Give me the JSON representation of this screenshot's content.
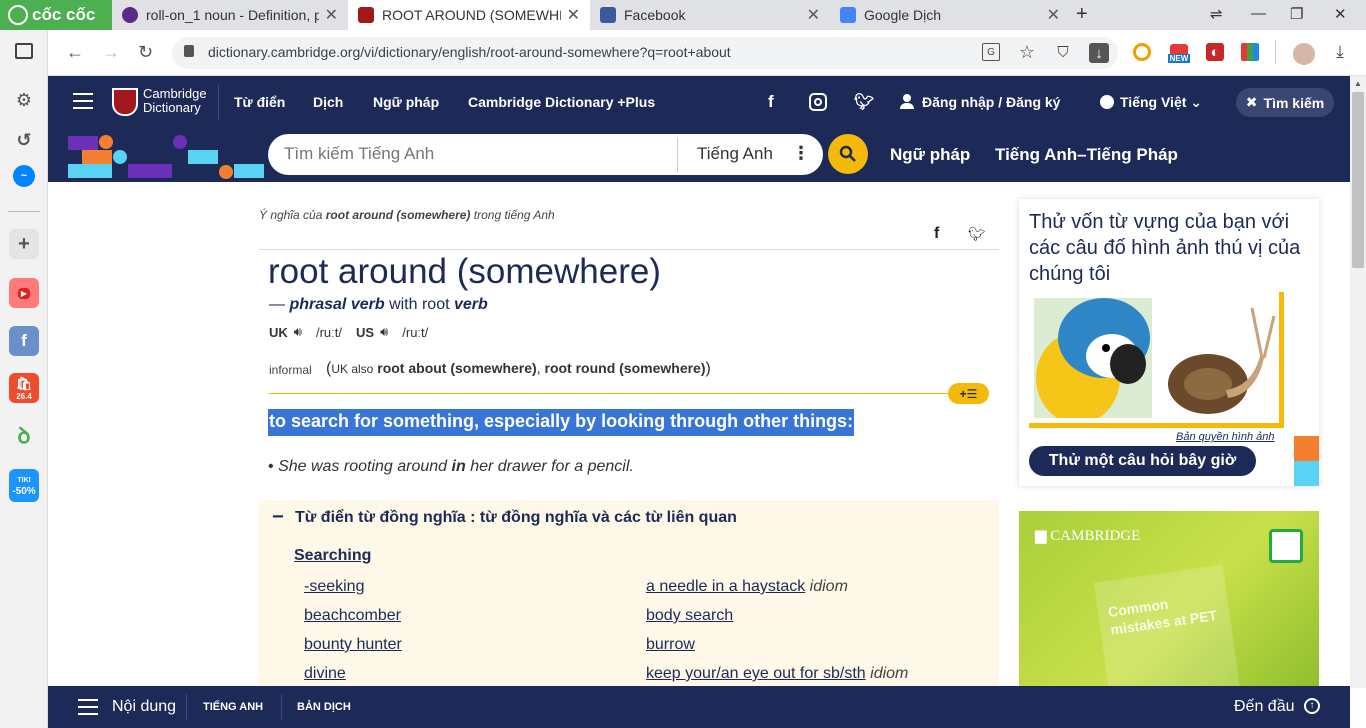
{
  "browser": {
    "brand": "cốc cốc",
    "tabs": [
      {
        "title": "roll-on_1 noun - Definition, p"
      },
      {
        "title": "ROOT AROUND (SOMEWHERE"
      },
      {
        "title": "Facebook"
      },
      {
        "title": "Google Dịch"
      }
    ],
    "url": "dictionary.cambridge.org/vi/dictionary/english/root-around-somewhere?q=root+about",
    "new_badge": "NEW"
  },
  "sidebar": {
    "shopee_badge": "26.4",
    "tiki": "TIKI",
    "tiki_sale": "-50%"
  },
  "header": {
    "logo_line1": "Cambridge",
    "logo_line2": "Dictionary",
    "nav": [
      "Từ điển",
      "Dịch",
      "Ngữ pháp",
      "Cambridge Dictionary +Plus"
    ],
    "login": "Đăng nhập / Đăng ký",
    "language": "Tiếng Việt",
    "search_button": "Tìm kiếm"
  },
  "search": {
    "placeholder": "Tìm kiếm Tiếng Anh",
    "dict_select": "Tiếng Anh",
    "links": [
      "Ngữ pháp",
      "Tiếng Anh–Tiếng Pháp"
    ]
  },
  "entry": {
    "crumb_pre": "Ý nghĩa của",
    "crumb_word": "root around (somewhere)",
    "crumb_post": "trong tiếng Anh",
    "headword": "root around (somewhere)",
    "pos_dash": "—",
    "pos": "phrasal verb",
    "pos_with": "with root",
    "pos_verb": "verb",
    "uk": "UK",
    "uk_ipa": "/ruːt/",
    "us": "US",
    "us_ipa": "/ruːt/",
    "register": "informal",
    "also_paren_open": "(",
    "also_uk": "UK also",
    "also_1": "root about (somewhere)",
    "also_comma": ",",
    "also_2": "root round (somewhere)",
    "also_paren_close": ")",
    "add_button": "+☰",
    "definition": "to search for something, especially by looking through other things:",
    "ex_pre": "She was rooting around",
    "ex_bold": "in",
    "ex_post": "her drawer for a pencil."
  },
  "thesaurus": {
    "toggle": "−",
    "title": "Từ điển từ đồng nghĩa : từ đồng nghĩa và các từ liên quan",
    "category": "Searching",
    "left": [
      "-seeking",
      "beachcomber",
      "bounty hunter",
      "divine"
    ],
    "right": [
      {
        "text": "a needle in a haystack",
        "tag": "idiom"
      },
      {
        "text": "body search",
        "tag": ""
      },
      {
        "text": "burrow",
        "tag": ""
      },
      {
        "text": "keep your/an eye out for sb/sth",
        "tag": "idiom"
      }
    ]
  },
  "quiz": {
    "title": "Thử vốn từ vựng của bạn với các câu đố hình ảnh thú vị của chúng tôi",
    "credit": "Bản quyền hình ảnh",
    "button": "Thử một câu hỏi bây giờ"
  },
  "ad": {
    "brand": "CAMBRIDGE",
    "book": "Common mistakes at PET"
  },
  "bottom": {
    "contents": "Nội dung",
    "tab1": "TIẾNG ANH",
    "tab2": "BẢN DỊCH",
    "top": "Đến đầu"
  },
  "colors": {
    "navy": "#1d2a57",
    "yellow": "#f5b909",
    "highlight": "#3875d7"
  }
}
